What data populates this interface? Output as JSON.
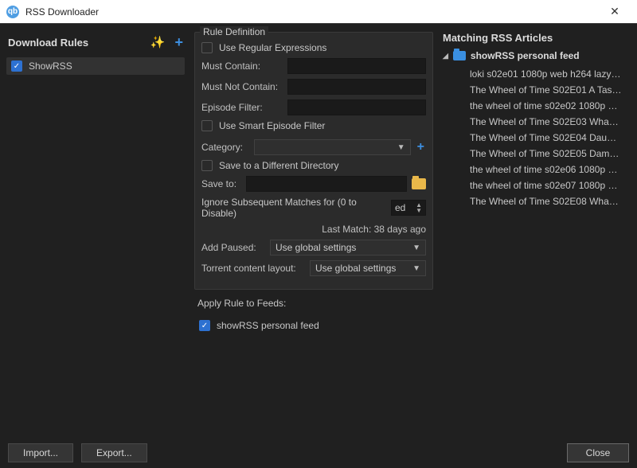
{
  "window": {
    "title": "RSS Downloader"
  },
  "rules": {
    "heading": "Download Rules",
    "items": [
      {
        "name": "ShowRSS",
        "checked": true
      }
    ]
  },
  "definition": {
    "group_title": "Rule Definition",
    "use_regex_label": "Use Regular Expressions",
    "must_contain_label": "Must Contain:",
    "must_contain_value": "",
    "must_not_contain_label": "Must Not Contain:",
    "must_not_contain_value": "",
    "episode_filter_label": "Episode Filter:",
    "episode_filter_value": "",
    "smart_filter_label": "Use Smart Episode Filter",
    "category_label": "Category:",
    "category_value": "",
    "save_diff_label": "Save to a Different Directory",
    "save_to_label": "Save to:",
    "save_to_value": "",
    "ignore_label": "Ignore Subsequent Matches for (0 to Disable)",
    "ignore_value": "ed",
    "last_match_label": "Last Match: 38 days ago",
    "add_paused_label": "Add Paused:",
    "add_paused_value": "Use global settings",
    "layout_label": "Torrent content layout:",
    "layout_value": "Use global settings"
  },
  "apply_feeds": {
    "title": "Apply Rule to Feeds:",
    "items": [
      {
        "name": "showRSS personal feed",
        "checked": true
      }
    ]
  },
  "articles_panel": {
    "heading": "Matching RSS Articles",
    "feed_name": "showRSS personal feed",
    "items": [
      "loki s02e01 1080p web h264 lazy…",
      "The Wheel of Time S02E01 A Tas…",
      "the wheel of time s02e02 1080p …",
      "The Wheel of Time S02E03 Wha…",
      "The Wheel of Time S02E04 Dau…",
      "The Wheel of Time S02E05 Dam…",
      "the wheel of time s02e06 1080p …",
      "the wheel of time s02e07 1080p …",
      "The Wheel of Time S02E08 Wha…"
    ]
  },
  "footer": {
    "import": "Import...",
    "export": "Export...",
    "close": "Close"
  }
}
